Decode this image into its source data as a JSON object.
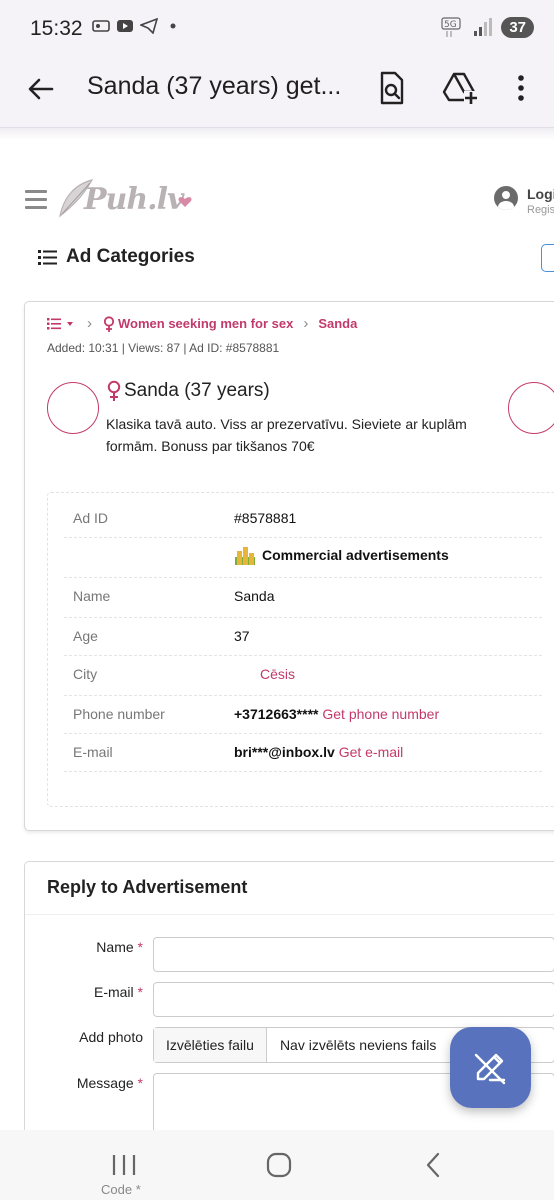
{
  "status_bar": {
    "time": "15:32",
    "network": "5G",
    "battery": "37"
  },
  "app_bar": {
    "title": "Sanda (37 years) get..."
  },
  "site": {
    "logo_text": "Puh.lv",
    "login_label": "Logi",
    "register_label": "Regis",
    "categories_title": "Ad Categories"
  },
  "ad": {
    "breadcrumb": {
      "category": "Women seeking men for sex",
      "current": "Sanda"
    },
    "meta": "Added: 10:31 | Views: 87 | Ad ID: #8578881",
    "title": "Sanda (37 years)",
    "description": "Klasika tavā auto. Viss ar prezervatīvu. Sieviete ar kuplām formām. Bonuss par tikšanos 70€",
    "details": {
      "ad_id_label": "Ad ID",
      "ad_id_value": "#8578881",
      "commercial_label": "Commercial advertisements",
      "name_label": "Name",
      "name_value": "Sanda",
      "age_label": "Age",
      "age_value": "37",
      "city_label": "City",
      "city_value": "Cēsis",
      "phone_label": "Phone number",
      "phone_value": "+3712663****",
      "phone_link": "Get phone number",
      "email_label": "E-mail",
      "email_value": "bri***@inbox.lv",
      "email_link": "Get e-mail"
    }
  },
  "reply": {
    "title": "Reply to Advertisement",
    "name_label": "Name",
    "email_label": "E-mail",
    "photo_label": "Add photo",
    "choose_file": "Izvēlēties failu",
    "no_file": "Nav izvēlēts neviens fails",
    "message_label": "Message",
    "code_label": "Code",
    "required_mark": "*"
  },
  "colors": {
    "accent": "#c23a6a",
    "fab": "#5872bd",
    "appbar_bg": "#f5f2f8"
  }
}
